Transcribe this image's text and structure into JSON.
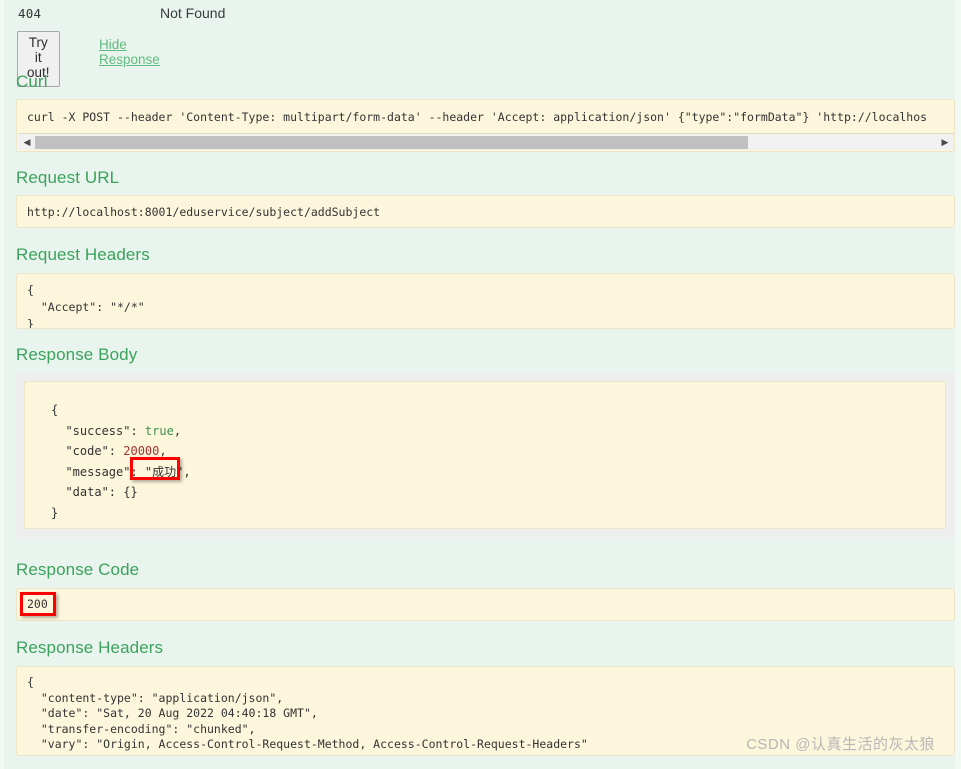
{
  "status": {
    "code": "404",
    "text": "Not Found"
  },
  "actions": {
    "try_it_out_label": "Try it out!",
    "hide_response_label": "Hide Response"
  },
  "sections": {
    "curl": {
      "heading": "Curl",
      "command": "curl -X POST --header 'Content-Type: multipart/form-data' --header 'Accept: application/json' {\"type\":\"formData\"} 'http://localhos",
      "scrollbar": {
        "left_arrow": "◀",
        "right_arrow": "▶"
      }
    },
    "request_url": {
      "heading": "Request URL",
      "value": "http://localhost:8001/eduservice/subject/addSubject"
    },
    "request_headers": {
      "heading": "Request Headers",
      "value": "{\n  \"Accept\": \"*/*\"\n}"
    },
    "response_body": {
      "heading": "Response Body",
      "lines": {
        "open_brace": "{",
        "success_key": "  \"success\": ",
        "success_value": "true",
        "code_key": "  \"code\": ",
        "code_value": "20000",
        "message_key": "  \"message\": ",
        "message_value": "\"成功\"",
        "data_line": "  \"data\": {}",
        "close_brace": "}",
        "comma": ","
      }
    },
    "response_code": {
      "heading": "Response Code",
      "value": "200"
    },
    "response_headers": {
      "heading": "Response Headers",
      "value": "{\n  \"content-type\": \"application/json\",\n  \"date\": \"Sat, 20 Aug 2022 04:40:18 GMT\",\n  \"transfer-encoding\": \"chunked\",\n  \"vary\": \"Origin, Access-Control-Request-Method, Access-Control-Request-Headers\"\n}"
    }
  },
  "annotations": {
    "message_highlight": "",
    "response_code_highlight": ""
  },
  "watermark": "CSDN @认真生活的灰太狼",
  "colors": {
    "page_background": "#eaf4ee",
    "heading_green": "#3aa35c",
    "code_background": "#fcf6dc",
    "code_border": "#ece5c6",
    "annotation_red": "#fe0000",
    "boolean_token": "#3f8f4f",
    "number_token": "#a33434",
    "link_green": "#60bb7e"
  }
}
